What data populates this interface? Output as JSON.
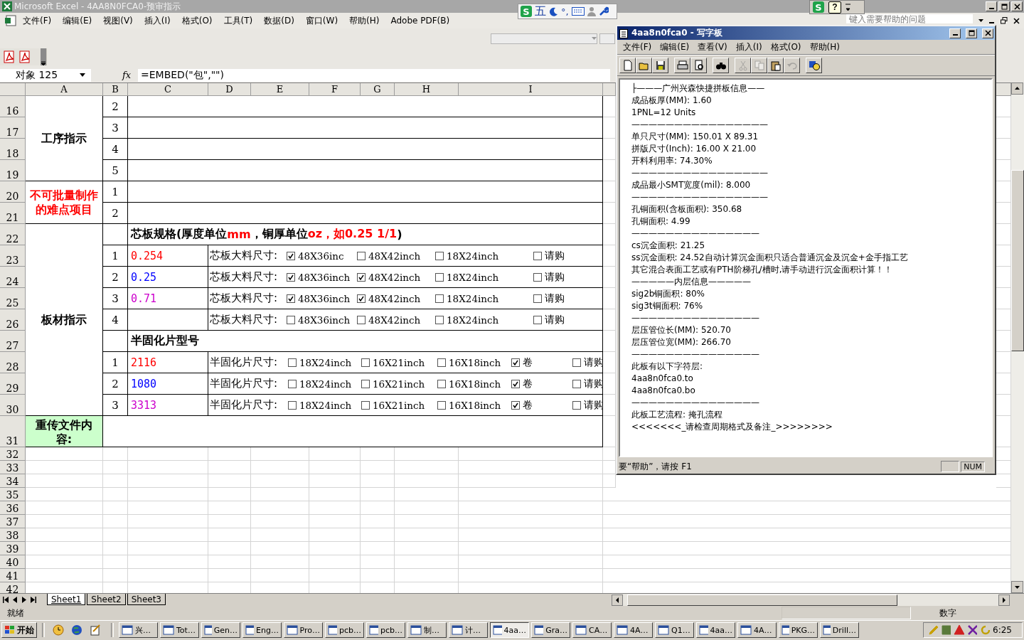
{
  "window": {
    "title": "Microsoft Excel - 4AA8N0FCA0-预审指示"
  },
  "ime_bar": {
    "logo": "S",
    "mode": "五",
    "punctuation": "°,"
  },
  "help_toolbar": {
    "logo": "S",
    "help": "?"
  },
  "menu": [
    "文件(F)",
    "编辑(E)",
    "视图(V)",
    "插入(I)",
    "格式(O)",
    "工具(T)",
    "数据(D)",
    "窗口(W)",
    "帮助(H)",
    "Adobe PDF(B)"
  ],
  "help_box": {
    "placeholder": "键入需要帮助的问题"
  },
  "formula_bar": {
    "name_box": "对象 125",
    "fx": "fx",
    "formula": "=EMBED(\"包\",\"\")"
  },
  "sheet": {
    "columns": [
      "A",
      "B",
      "C",
      "D",
      "E",
      "F",
      "G",
      "H",
      "I"
    ],
    "row_numbers": [
      "16",
      "17",
      "18",
      "19",
      "20",
      "21",
      "22",
      "23",
      "24",
      "25",
      "26",
      "27",
      "28",
      "29",
      "30",
      "31",
      "32",
      "33",
      "34",
      "35",
      "36",
      "37",
      "38",
      "39",
      "40",
      "41",
      "42"
    ],
    "sections": [
      {
        "kind": "list",
        "label": "工序指示",
        "warning": false,
        "items": [
          "2",
          "3",
          "4",
          "5"
        ]
      },
      {
        "kind": "list",
        "label": "不可批量制作的难点项目",
        "warning": true,
        "items": [
          "1",
          "2"
        ]
      },
      {
        "kind": "materials",
        "label": "板材指示",
        "groups": [
          {
            "kind": "core",
            "heading": [
              {
                "text": "芯板规格(厚度单位",
                "color": "#000000"
              },
              {
                "text": "mm",
                "color": "#ff0000"
              },
              {
                "text": "，铜厚单位",
                "color": "#000000"
              },
              {
                "text": "oz，如0.25 1/1",
                "color": "#ff0000"
              },
              {
                "text": ")",
                "color": "#000000"
              }
            ],
            "rows": [
              {
                "number": "1",
                "value": "0.254",
                "color": "#ff0000",
                "label": "芯板大料尺寸:",
                "options": [
                  {
                    "label": "48X36inc",
                    "checked": true
                  },
                  {
                    "label": "48X42inch",
                    "checked": false
                  },
                  {
                    "label": "18X24inch",
                    "checked": false
                  },
                  {
                    "label": "请购",
                    "checked": false
                  }
                ]
              },
              {
                "number": "2",
                "value": "0.25",
                "color": "#0000ff",
                "label": "芯板大料尺寸:",
                "options": [
                  {
                    "label": "48X36inch",
                    "checked": true
                  },
                  {
                    "label": "48X42inch",
                    "checked": true
                  },
                  {
                    "label": "18X24inch",
                    "checked": false
                  },
                  {
                    "label": "请购",
                    "checked": false
                  }
                ]
              },
              {
                "number": "3",
                "value": "0.71",
                "color": "#cc00cc",
                "label": "芯板大料尺寸:",
                "options": [
                  {
                    "label": "48X36inch",
                    "checked": true
                  },
                  {
                    "label": "48X42inch",
                    "checked": true
                  },
                  {
                    "label": "18X24inch",
                    "checked": false
                  },
                  {
                    "label": "请购",
                    "checked": false
                  }
                ]
              },
              {
                "number": "4",
                "label": "芯板大料尺寸:",
                "options": [
                  {
                    "label": "48X36inch",
                    "checked": false
                  },
                  {
                    "label": "48X42inch",
                    "checked": false
                  },
                  {
                    "label": "18X24inch",
                    "checked": false
                  },
                  {
                    "label": "请购",
                    "checked": false
                  }
                ]
              }
            ]
          },
          {
            "kind": "prepreg",
            "heading": [
              {
                "text": "半固化片型号",
                "color": "#000000"
              }
            ],
            "rows": [
              {
                "number": "1",
                "value": "2116",
                "color": "#ff0000",
                "label": "半固化片尺寸:",
                "options": [
                  {
                    "label": "18X24inch",
                    "checked": false
                  },
                  {
                    "label": "16X21inch",
                    "checked": false
                  },
                  {
                    "label": "16X18inch",
                    "checked": false
                  },
                  {
                    "label": "卷",
                    "checked": true
                  },
                  {
                    "label": "请购",
                    "checked": false
                  }
                ]
              },
              {
                "number": "2",
                "value": "1080",
                "color": "#0000ff",
                "label": "半固化片尺寸:",
                "options": [
                  {
                    "label": "18X24inch",
                    "checked": false
                  },
                  {
                    "label": "16X21inch",
                    "checked": false
                  },
                  {
                    "label": "16X18inch",
                    "checked": false
                  },
                  {
                    "label": "卷",
                    "checked": true
                  },
                  {
                    "label": "请购",
                    "checked": false
                  }
                ]
              },
              {
                "number": "3",
                "value": "3313",
                "color": "#cc00cc",
                "label": "半固化片尺寸:",
                "options": [
                  {
                    "label": "18X24inch",
                    "checked": false
                  },
                  {
                    "label": "16X21inch",
                    "checked": false
                  },
                  {
                    "label": "16X18inch",
                    "checked": false
                  },
                  {
                    "label": "卷",
                    "checked": true
                  },
                  {
                    "label": "请购",
                    "checked": false
                  }
                ]
              }
            ]
          }
        ]
      },
      {
        "kind": "upload",
        "label": "重传文件内容:"
      }
    ]
  },
  "wordpad": {
    "title": "4aa8n0fca0 - 写字板",
    "menu": [
      "文件(F)",
      "编辑(E)",
      "查看(V)",
      "插入(I)",
      "格式(O)",
      "帮助(H)"
    ],
    "toolbar": [
      {
        "disabled": false
      },
      {
        "disabled": false
      },
      {
        "disabled": false
      },
      {
        "disabled": false
      },
      {
        "disabled": false
      },
      {
        "disabled": false
      },
      {
        "disabled": true
      },
      {
        "disabled": true
      },
      {
        "disabled": false
      },
      {
        "disabled": true
      },
      {
        "disabled": false
      }
    ],
    "lines": [
      "├———广州兴森快捷拼板信息——",
      "成品板厚(MM): 1.60",
      "1PNL=12 Units",
      "————————————————",
      "单只尺寸(MM): 150.01 X 89.31",
      "拼版尺寸(Inch): 16.00 X 21.00",
      "开料利用率: 74.30%",
      "————————————————",
      "成品最小SMT宽度(mil): 8.000",
      "————————————————",
      "孔铜面积(含板面积): 350.68",
      "孔铜面积: 4.99",
      "———————————————",
      "cs沉金面积: 21.25",
      "ss沉金面积: 24.52自动计算沉金面积只适合普通沉金及沉金+金手指工艺",
      "其它混合表面工艺或有PTH阶梯孔/槽时,请手动进行沉金面积计算！！",
      "—————内层信息—————",
      "sig2b铜面积: 80%",
      "sig3t铜面积: 76%",
      "———————————————",
      "层压管位长(MM): 520.70",
      "层压管位宽(MM): 266.70",
      "———————————————",
      "此板有以下字符层:",
      "4aa8n0fca0.to",
      "4aa8n0fca0.bo",
      "———————————————",
      "此板工艺流程: 掩孔流程",
      "<<<<<<<_请检查周期格式及备注_>>>>>>>>"
    ],
    "status": "要“帮助”，请按 F1",
    "indicator": "NUM"
  },
  "sheet_tabs": [
    {
      "label": "Sheet1",
      "selected": true
    },
    {
      "label": "Sheet2",
      "selected": false
    },
    {
      "label": "Sheet3",
      "selected": false
    }
  ],
  "status_bar": {
    "text": "就绪",
    "mode": "数字"
  },
  "taskbar": {
    "start": "开始",
    "tasks": [
      {
        "label": "兴…",
        "selected": false
      },
      {
        "label": "Tot…",
        "selected": false
      },
      {
        "label": "Gen…",
        "selected": false
      },
      {
        "label": "Eng…",
        "selected": false
      },
      {
        "label": "Pro…",
        "selected": false
      },
      {
        "label": "pcb…",
        "selected": false
      },
      {
        "label": "pcb…",
        "selected": false
      },
      {
        "label": "制…",
        "selected": false
      },
      {
        "label": "计…",
        "selected": false
      },
      {
        "label": "4aa…",
        "selected": true
      },
      {
        "label": "Gra…",
        "selected": false
      },
      {
        "label": "CA…",
        "selected": false
      },
      {
        "label": "4A…",
        "selected": false
      },
      {
        "label": "Q1…",
        "selected": false
      },
      {
        "label": "4aa…",
        "selected": false
      },
      {
        "label": "4A…",
        "selected": false
      },
      {
        "label": "PKG…",
        "selected": false
      },
      {
        "label": "Drill…",
        "selected": false
      }
    ],
    "clock": "6:25"
  }
}
